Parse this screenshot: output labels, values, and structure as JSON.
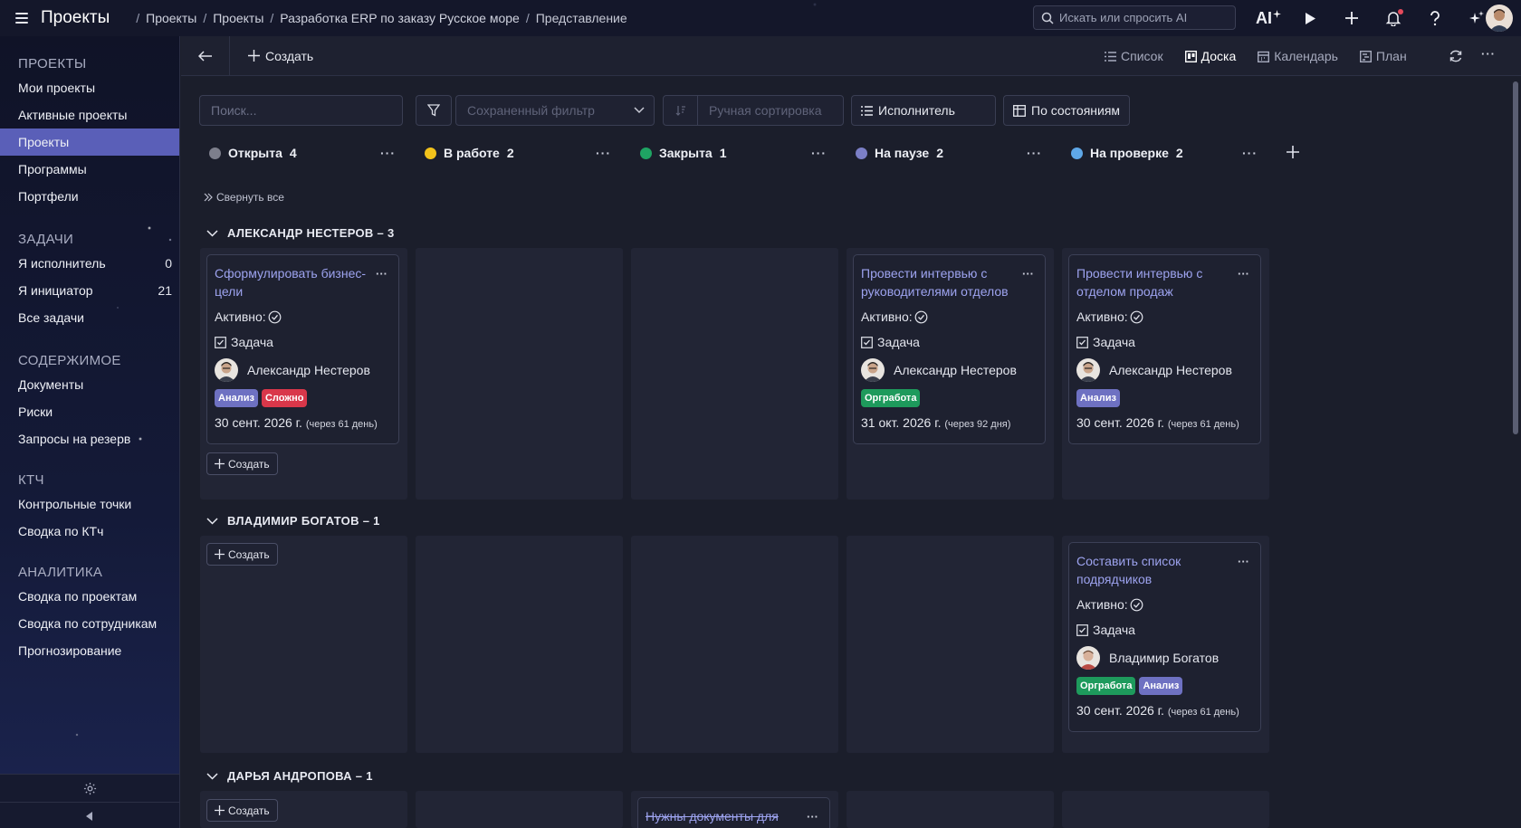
{
  "app": {
    "title": "Проекты"
  },
  "breadcrumb": [
    "Проекты",
    "Проекты",
    "Разработка ERP по заказу Русское море",
    "Представление"
  ],
  "search": {
    "placeholder": "Искать или спросить AI"
  },
  "topicons": {
    "ai": "AI"
  },
  "sidebar": {
    "sections": [
      {
        "title": "ПРОЕКТЫ",
        "items": [
          {
            "label": "Мои проекты"
          },
          {
            "label": "Активные проекты"
          },
          {
            "label": "Проекты"
          },
          {
            "label": "Программы"
          },
          {
            "label": "Портфели"
          }
        ]
      },
      {
        "title": "ЗАДАЧИ",
        "items": [
          {
            "label": "Я исполнитель",
            "count": "0"
          },
          {
            "label": "Я инициатор",
            "count": "21"
          },
          {
            "label": "Все задачи"
          }
        ]
      },
      {
        "title": "СОДЕРЖИМОЕ",
        "items": [
          {
            "label": "Документы"
          },
          {
            "label": "Риски"
          },
          {
            "label": "Запросы на резерв"
          }
        ]
      },
      {
        "title": "КТЧ",
        "items": [
          {
            "label": "Контрольные точки"
          },
          {
            "label": "Сводка по КТч"
          }
        ]
      },
      {
        "title": "АНАЛИТИКА",
        "items": [
          {
            "label": "Сводка по проектам"
          },
          {
            "label": "Сводка по сотрудникам"
          },
          {
            "label": "Прогнозирование"
          }
        ]
      }
    ]
  },
  "toolbar": {
    "create_label": "Создать",
    "views": [
      "Список",
      "Доска",
      "Календарь",
      "План"
    ]
  },
  "filters": {
    "search_placeholder": "Поиск...",
    "saved_filter_placeholder": "Сохраненный фильтр",
    "sort_placeholder": "Ручная сортировка",
    "group_by": "Исполнитель",
    "by_state": "По состояниям"
  },
  "columns": [
    {
      "name": "Открыта",
      "count": "4",
      "color": "#7d7f8c"
    },
    {
      "name": "В работе",
      "count": "2",
      "color": "#f2c21b"
    },
    {
      "name": "Закрыта",
      "count": "1",
      "color": "#1fa463"
    },
    {
      "name": "На паузе",
      "count": "2",
      "color": "#7b7fc6"
    },
    {
      "name": "На проверке",
      "count": "2",
      "color": "#5fa8e8"
    }
  ],
  "collapse_all": "Свернуть все",
  "groups": [
    {
      "title": "АЛЕКСАНДР НЕСТЕРОВ – 3"
    },
    {
      "title": "ВЛАДИМИР БОГАТОВ – 1"
    },
    {
      "title": "ДАРЬЯ АНДРОПОВА – 1"
    }
  ],
  "create_card_label": "Создать",
  "card_labels": {
    "active": "Активно:",
    "type": "Задача"
  },
  "cards": [
    {
      "title": "Сформулировать бизнес-цели",
      "assignee": "Александр Нестеров",
      "tags": [
        {
          "label": "Анализ",
          "color": "#6e71c2"
        },
        {
          "label": "Сложно",
          "color": "#d9374a"
        }
      ],
      "date": "30 сент. 2026 г.",
      "relative": "(через 61 день)"
    },
    {
      "title": "Провести интервью с руководителями отделов",
      "assignee": "Александр Нестеров",
      "tags": [
        {
          "label": "Оргработа",
          "color": "#1e9a5c"
        }
      ],
      "date": "31 окт. 2026 г.",
      "relative": "(через 92 дня)"
    },
    {
      "title": "Провести интервью с отделом продаж",
      "assignee": "Александр Нестеров",
      "tags": [
        {
          "label": "Анализ",
          "color": "#6e71c2"
        }
      ],
      "date": "30 сент. 2026 г.",
      "relative": "(через 61 день)"
    },
    {
      "title": "Составить список подрядчиков",
      "assignee": "Владимир Богатов",
      "tags": [
        {
          "label": "Оргработа",
          "color": "#1e9a5c"
        },
        {
          "label": "Анализ",
          "color": "#6e71c2"
        }
      ],
      "date": "30 сент. 2026 г.",
      "relative": "(через 61 день)"
    },
    {
      "title": "Нужны документы для"
    }
  ]
}
